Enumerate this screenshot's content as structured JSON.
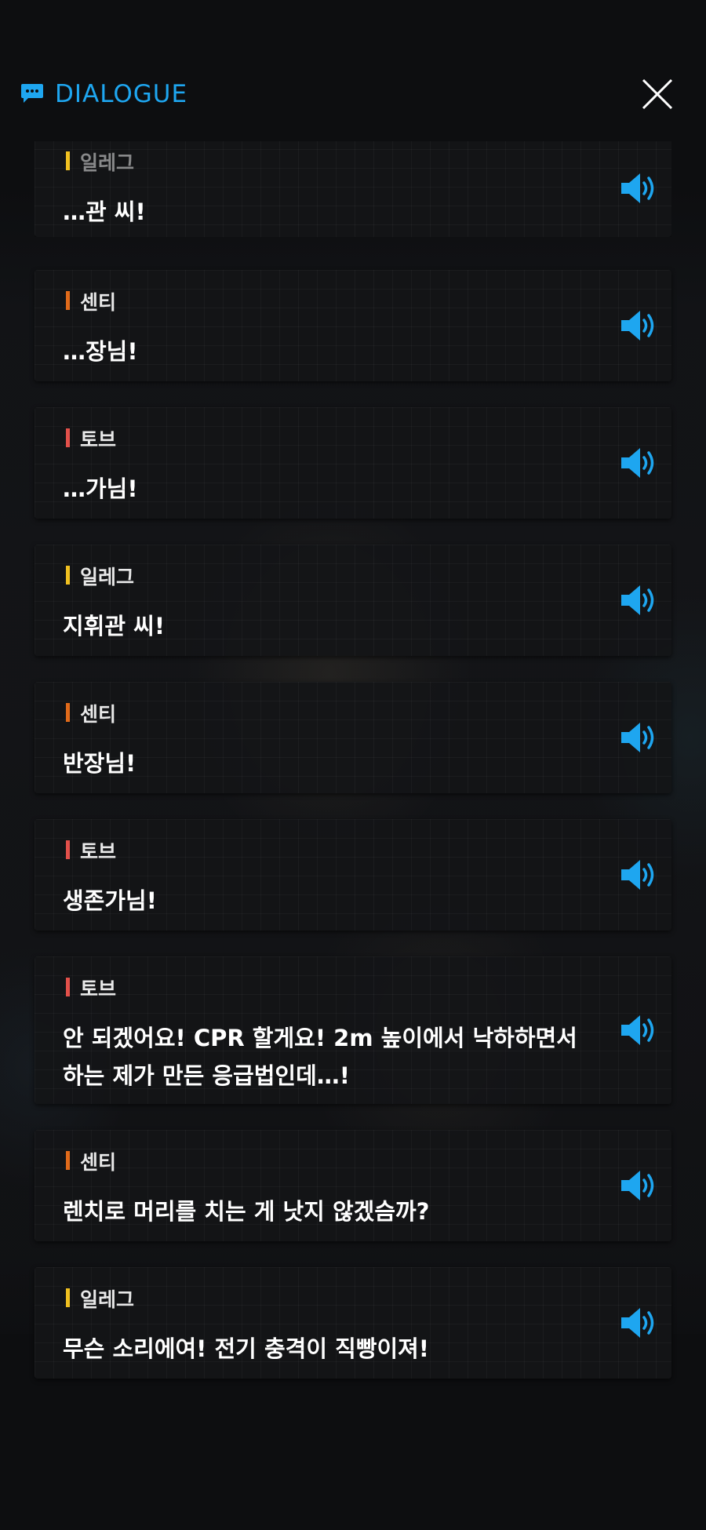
{
  "header": {
    "title": "DIALOGUE",
    "close_label": "close"
  },
  "colors": {
    "accent": "#1ea6f0",
    "speaker_yellow": "#f0c020",
    "speaker_orange": "#e06a1a",
    "speaker_red": "#e2504a"
  },
  "dialogue": [
    {
      "speaker": "일레그",
      "text": "…관 씨!",
      "bar_color": "#f0c020"
    },
    {
      "speaker": "센티",
      "text": "…장님!",
      "bar_color": "#e06a1a"
    },
    {
      "speaker": "토브",
      "text": "…가님!",
      "bar_color": "#e2504a"
    },
    {
      "speaker": "일레그",
      "text": "지휘관 씨!",
      "bar_color": "#f0c020"
    },
    {
      "speaker": "센티",
      "text": "반장님!",
      "bar_color": "#e06a1a"
    },
    {
      "speaker": "토브",
      "text": "생존가님!",
      "bar_color": "#e2504a"
    },
    {
      "speaker": "토브",
      "text_lines": [
        "안 되겠어요! CPR 할게요! 2m 높이에서 낙하하면서",
        "하는 제가 만든 응급법인데…!"
      ],
      "bar_color": "#e2504a"
    },
    {
      "speaker": "센티",
      "text": "렌치로 머리를 치는 게 낫지 않겠슴까?",
      "bar_color": "#e06a1a"
    },
    {
      "speaker": "일레그",
      "text": "무슨 소리에여! 전기 충격이 직빵이져!",
      "bar_color": "#f0c020"
    }
  ]
}
